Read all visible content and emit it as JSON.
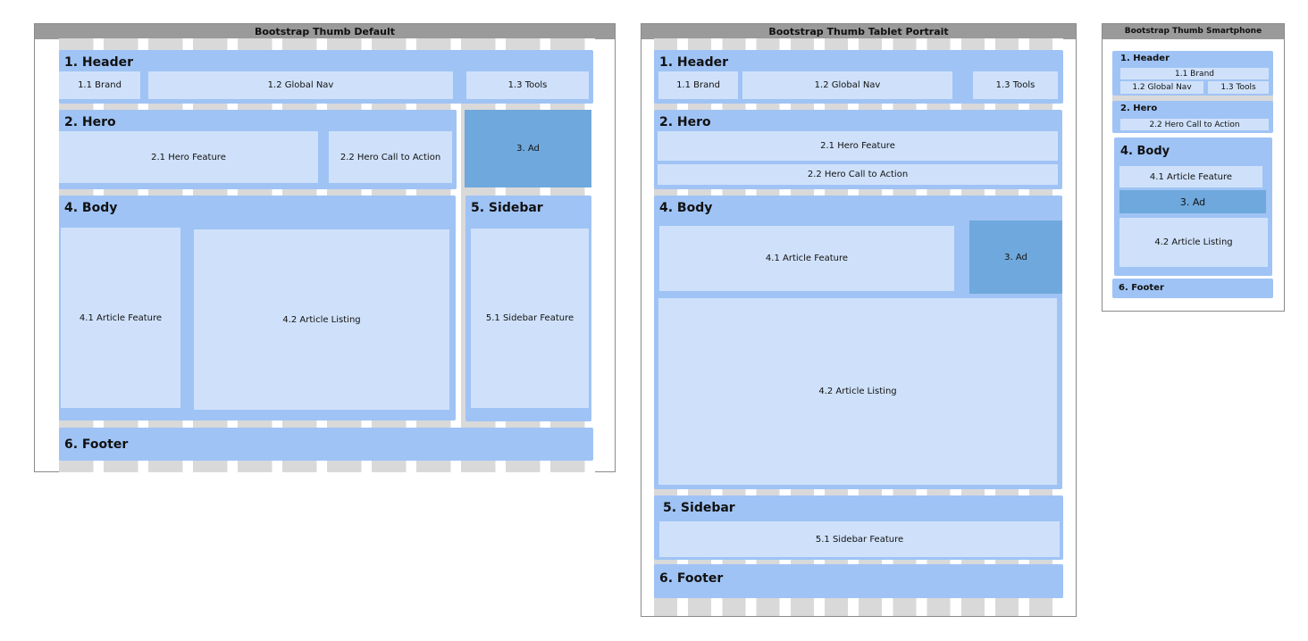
{
  "frames": {
    "default": {
      "title": "Bootstrap Thumb Default",
      "header": "1. Header",
      "brand": "1.1 Brand",
      "nav": "1.2 Global Nav",
      "tools": "1.3 Tools",
      "hero": "2. Hero",
      "hero_feature": "2.1 Hero Feature",
      "hero_cta": "2.2 Hero Call to Action",
      "ad": "3. Ad",
      "body": "4. Body",
      "article_feature": "4.1 Article Feature",
      "article_listing": "4.2 Article Listing",
      "sidebar": "5. Sidebar",
      "sidebar_feature": "5.1 Sidebar Feature",
      "footer": "6. Footer"
    },
    "tablet": {
      "title": "Bootstrap Thumb Tablet Portrait",
      "header": "1. Header",
      "brand": "1.1 Brand",
      "nav": "1.2 Global Nav",
      "tools": "1.3 Tools",
      "hero": "2. Hero",
      "hero_feature": "2.1 Hero Feature",
      "hero_cta": "2.2 Hero Call to Action",
      "ad": "3. Ad",
      "body": "4. Body",
      "article_feature": "4.1 Article Feature",
      "article_listing": "4.2 Article Listing",
      "sidebar": "5. Sidebar",
      "sidebar_feature": "5.1 Sidebar Feature",
      "footer": "6. Footer"
    },
    "smartphone": {
      "title": "Bootstrap Thumb Smartphone",
      "header": "1. Header",
      "brand": "1.1 Brand",
      "nav": "1.2 Global Nav",
      "tools": "1.3 Tools",
      "hero": "2. Hero",
      "hero_cta": "2.2 Hero Call to Action",
      "ad": "3. Ad",
      "body": "4. Body",
      "article_feature": "4.1 Article Feature",
      "article_listing": "4.2 Article Listing",
      "footer": "6. Footer"
    }
  },
  "colors": {
    "section": "#9fc3f5",
    "inner": "#cfe1fa",
    "ad": "#6fa8dc",
    "titlebar": "#9a9a9a",
    "grid": "#d9d9d9"
  }
}
